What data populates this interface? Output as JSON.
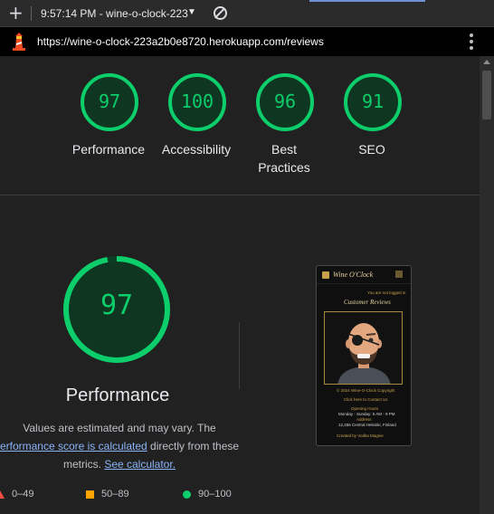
{
  "browser": {
    "time_label": "9:57:14 PM - wine-o-clock-223",
    "url": "https://wine-o-clock-223a2b0e8720.herokuapp.com/reviews"
  },
  "summary_scores": [
    {
      "value": "97",
      "label": "Performance"
    },
    {
      "value": "100",
      "label": "Accessibility"
    },
    {
      "value": "96",
      "label_line1": "Best",
      "label_line2": "Practices"
    },
    {
      "value": "91",
      "label": "SEO"
    }
  ],
  "performance": {
    "score": "97",
    "title": "Performance",
    "note_line1": "Values are estimated and may vary. The",
    "note_link1": "erformance score is calculated",
    "note_line2_rest": " directly from these",
    "note_line3": "metrics.",
    "note_link2": "See calculator."
  },
  "legend": [
    {
      "label": "0–49",
      "color": "#ff4e42"
    },
    {
      "label": "50–89",
      "color": "#ffa400"
    },
    {
      "label": "90–100",
      "color": "#0cce6b"
    }
  ],
  "colors": {
    "pass": "#0cce6b",
    "average": "#ffa400",
    "fail": "#ff4e42"
  },
  "screenshot": {
    "brand": "Wine O'Clock",
    "login_note": "You are not logged in",
    "heading": "Customer Reviews",
    "copyright": "© 2024 Wine-O-Clock Copyright",
    "find_us": "Click here to Contact Us",
    "hours_title": "Opening Hours",
    "hours": "Monday - Sunday: 5 AM - 9 PM",
    "address_title": "Address",
    "address": "12,456 Central Helsinki, Finland",
    "created_by": "Created by Vodka Magnie"
  }
}
